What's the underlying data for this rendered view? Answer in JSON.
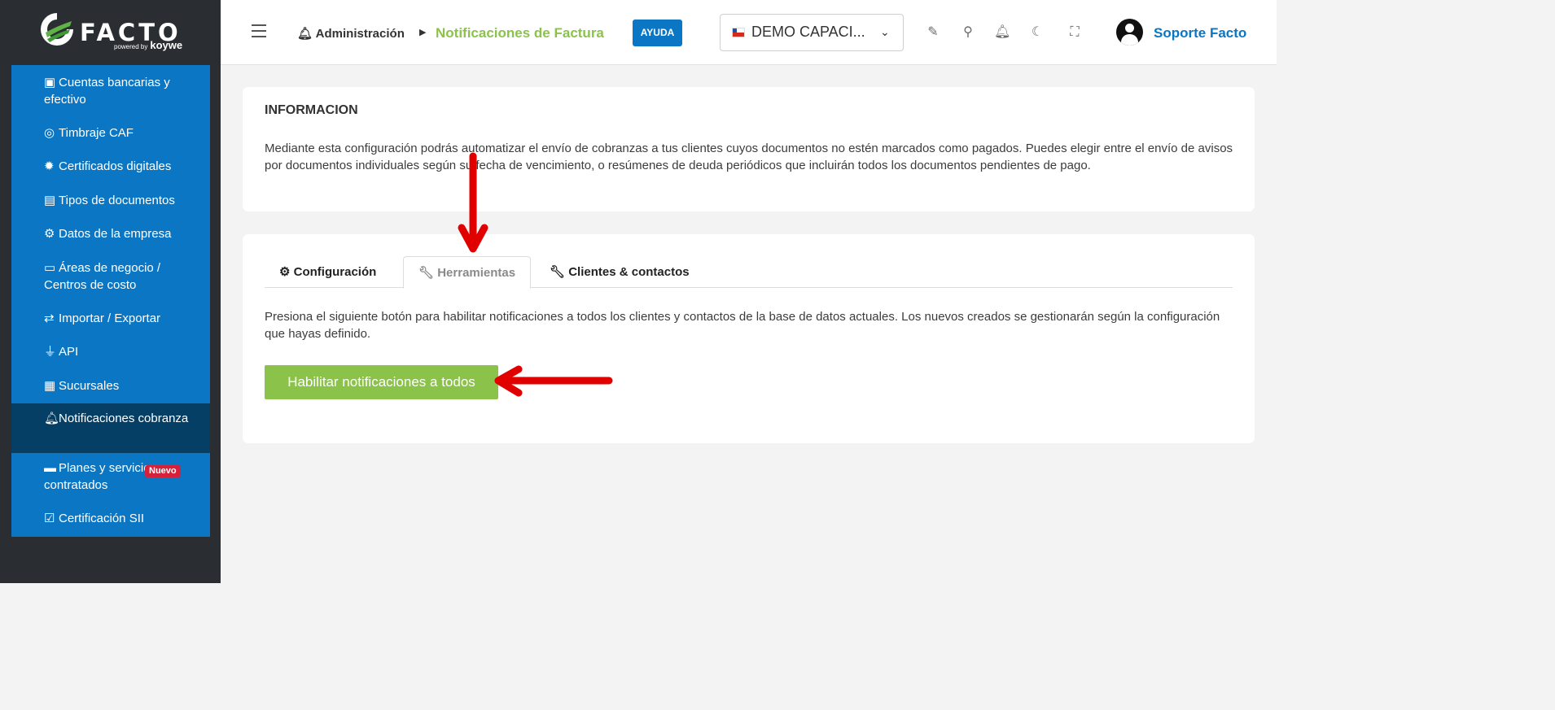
{
  "brand": {
    "name": "FACTO",
    "powered": "powered by",
    "partner": "koywe"
  },
  "sidebar": {
    "items": [
      {
        "label": "Cuentas bancarias y efectivo",
        "icon": "money-icon"
      },
      {
        "label": "Timbraje CAF",
        "icon": "target-icon"
      },
      {
        "label": "Certificados digitales",
        "icon": "certificate-icon"
      },
      {
        "label": "Tipos de documentos",
        "icon": "document-icon"
      },
      {
        "label": "Datos de la empresa",
        "icon": "gear-icon"
      },
      {
        "label": "Áreas de negocio / Centros de costo",
        "icon": "archive-icon"
      },
      {
        "label": "Importar / Exportar",
        "icon": "exchange-icon"
      },
      {
        "label": "API",
        "icon": "plug-icon"
      },
      {
        "label": "Sucursales",
        "icon": "building-icon"
      },
      {
        "label": "Notificaciones cobranza",
        "icon": "bell-icon",
        "active": true
      },
      {
        "label": "Planes y servicios contratados",
        "icon": "card-icon",
        "badge": "Nuevo"
      },
      {
        "label": "Certificación SII",
        "icon": "check-square-icon"
      }
    ]
  },
  "topbar": {
    "breadcrumb_parent": "Administración",
    "breadcrumb_current": "Notificaciones de Factura",
    "help_label": "AYUDA",
    "company": "DEMO CAPACI...",
    "user": "Soporte Facto"
  },
  "info": {
    "title": "INFORMACION",
    "text": "Mediante esta configuración podrás automatizar el envío de cobranzas a tus clientes cuyos documentos no estén marcados como pagados. Puedes elegir entre el envío de avisos por documentos individuales según su fecha de vencimiento, o resúmenes de deuda periódicos que incluirán todos los documentos pendientes de pago."
  },
  "tabs": [
    {
      "label": "Configuración",
      "icon": "gears-icon"
    },
    {
      "label": "Herramientas",
      "icon": "wrench-icon",
      "active": true
    },
    {
      "label": "Clientes & contactos",
      "icon": "wrench-icon"
    }
  ],
  "tools": {
    "text": "Presiona el siguiente botón para habilitar notificaciones a todos los clientes y contactos de la base de datos actuales. Los nuevos creados se gestionarán según la configuración que hayas definido.",
    "button_label": "Habilitar notificaciones a todos"
  },
  "colors": {
    "sidebar_bg": "#2a2d31",
    "menu_blue": "#0a76c4",
    "menu_active": "#063f66",
    "accent_green": "#8bc34a",
    "arrow_red": "#e00000"
  }
}
